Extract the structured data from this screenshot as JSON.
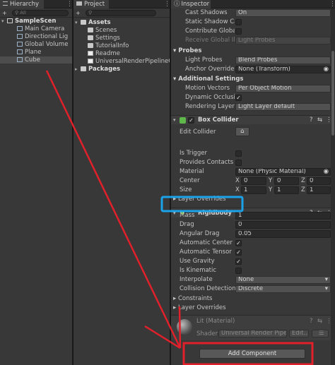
{
  "hierarchy": {
    "tab": "Hierarchy",
    "add": "+",
    "filter": "All",
    "scene": "SampleScen",
    "items": [
      "Main Camera",
      "Directional Lig",
      "Global Volume",
      "Plane",
      "Cube"
    ],
    "selected_index": 4
  },
  "project": {
    "tab": "Project",
    "add": "+",
    "assets": "Assets",
    "folders": [
      "Scenes",
      "Settings",
      "TutorialInfo"
    ],
    "files": [
      "Readme",
      "UniversalRenderPipelineGlo"
    ],
    "packages": "Packages"
  },
  "inspector": {
    "tab": "Inspector",
    "top_rows": [
      {
        "label": "Cast Shadows",
        "value": "On",
        "kind": "dropdown"
      },
      {
        "label": "Static Shadow Cas",
        "kind": "check",
        "checked": false
      },
      {
        "label": "Contribute Global I",
        "kind": "check",
        "checked": false
      },
      {
        "label": "Receive Global Illu",
        "value": "Light Probes",
        "kind": "dropdown",
        "disabled": true
      }
    ],
    "probes": {
      "title": "Probes",
      "rows": [
        {
          "label": "Light Probes",
          "value": "Blend Probes"
        },
        {
          "label": "Anchor Override",
          "value": "None (Transform)"
        }
      ]
    },
    "additional": {
      "title": "Additional Settings",
      "rows": [
        {
          "label": "Motion Vectors",
          "value": "Per Object Motion",
          "kind": "dropdown"
        },
        {
          "label": "Dynamic Occlusion",
          "kind": "check",
          "checked": true
        },
        {
          "label": "Rendering Layer M",
          "value": "Light Layer default",
          "kind": "dropdown"
        }
      ]
    },
    "box_collider": {
      "title": "Box Collider",
      "edit_collider": "Edit Collider",
      "is_trigger": "Is Trigger",
      "provides_contacts": "Provides Contacts",
      "material_label": "Material",
      "material_value": "None (Physic Material)",
      "center_label": "Center",
      "center": {
        "x": "0",
        "y": "0",
        "z": "0"
      },
      "size_label": "Size",
      "size": {
        "x": "1",
        "y": "1",
        "z": "1"
      },
      "layer_overrides": "Layer Overrides"
    },
    "rigidbody": {
      "title": "Rigidbody",
      "mass_label": "Mass",
      "mass": "1",
      "drag_label": "Drag",
      "drag": "0",
      "angular_drag_label": "Angular Drag",
      "angular_drag": "0.05",
      "auto_center_label": "Automatic Center Of",
      "auto_tensor_label": "Automatic Tensor",
      "use_gravity_label": "Use Gravity",
      "is_kinematic_label": "Is Kinematic",
      "interpolate_label": "Interpolate",
      "interpolate": "None",
      "collision_label": "Collision Detection",
      "collision": "Discrete",
      "constraints": "Constraints",
      "layer_overrides": "Layer Overrides"
    },
    "material": {
      "name": "Lit (Material)",
      "shader_label": "Shader",
      "shader": "Universal Render Pipeli",
      "edit": "Edit..."
    },
    "add_component": "Add Component",
    "axis_labels": {
      "x": "X",
      "y": "Y",
      "z": "Z"
    },
    "check_mark": "✓",
    "help_icon": "?",
    "settings_icon": "⇆",
    "menu_icon": "⋮"
  },
  "annotation": {
    "highlight_color": "#1aa3e8",
    "box_color": "#e0202a",
    "arrow_color": "#e0202a"
  }
}
